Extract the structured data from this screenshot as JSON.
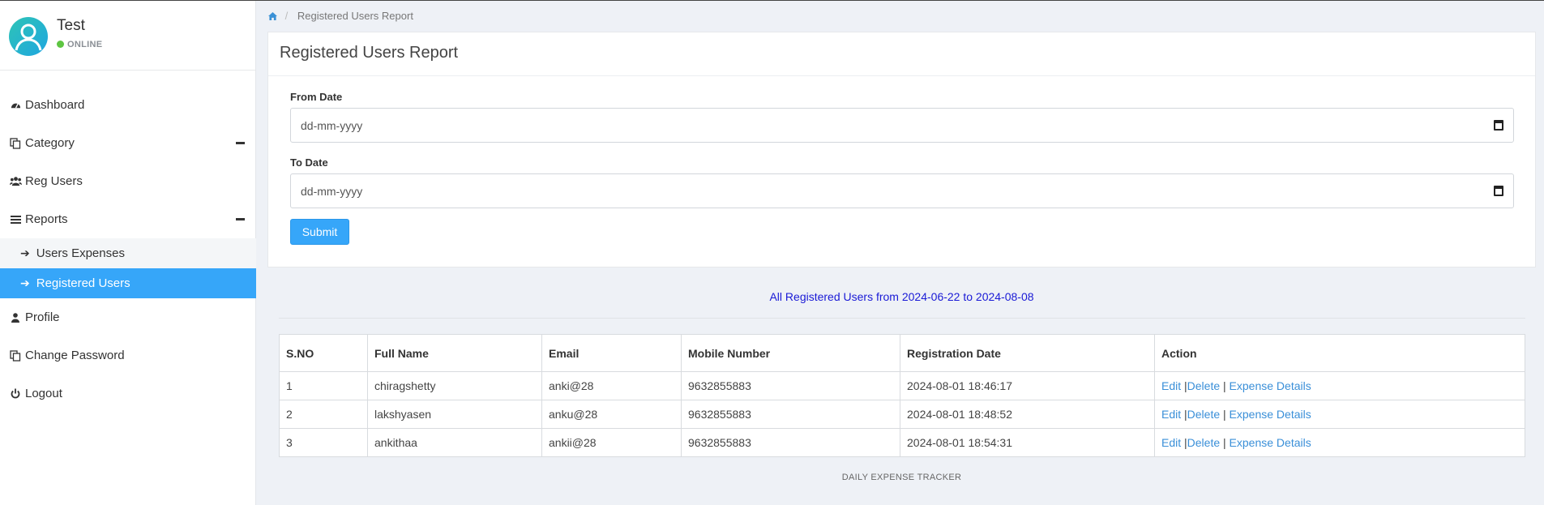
{
  "user": {
    "name": "Test",
    "status": "ONLINE"
  },
  "sidebar": {
    "items": [
      {
        "label": "Dashboard",
        "icon": "dashboard-icon"
      },
      {
        "label": "Category",
        "icon": "copy-icon",
        "expanded": true
      },
      {
        "label": "Reg Users",
        "icon": "users-icon"
      },
      {
        "label": "Reports",
        "icon": "bars-icon",
        "expanded": true
      },
      {
        "label": "Profile",
        "icon": "user-icon"
      },
      {
        "label": "Change Password",
        "icon": "copy-icon"
      },
      {
        "label": "Logout",
        "icon": "power-icon"
      }
    ],
    "reports_sub": [
      {
        "label": "Users Expenses"
      },
      {
        "label": "Registered Users",
        "active": true
      }
    ]
  },
  "breadcrumb": {
    "current": "Registered Users Report"
  },
  "panel": {
    "title": "Registered Users Report",
    "from_label": "From Date",
    "from_placeholder": "dd-mm-yyyy",
    "to_label": "To Date",
    "to_placeholder": "dd-mm-yyyy",
    "submit_label": "Submit"
  },
  "report": {
    "title": "All Registered Users from 2024-06-22 to 2024-08-08",
    "columns": [
      "S.NO",
      "Full Name",
      "Email",
      "Mobile Number",
      "Registration Date",
      "Action"
    ],
    "rows": [
      {
        "sno": "1",
        "name": "chiragshetty",
        "email": "anki@28",
        "mobile": "9632855883",
        "date": "2024-08-01 18:46:17"
      },
      {
        "sno": "2",
        "name": "lakshyasen",
        "email": "anku@28",
        "mobile": "9632855883",
        "date": "2024-08-01 18:48:52"
      },
      {
        "sno": "3",
        "name": "ankithaa",
        "email": "ankii@28",
        "mobile": "9632855883",
        "date": "2024-08-01 18:54:31"
      }
    ],
    "actions": {
      "edit": "Edit",
      "delete": "Delete",
      "details": "Expense Details",
      "sep": "|"
    }
  },
  "footer": {
    "text": "DAILY EXPENSE TRACKER"
  },
  "colors": {
    "accent": "#36a6f9",
    "link": "#3a8fd8",
    "report_title": "#1a1ad6",
    "online": "#5ec542"
  }
}
